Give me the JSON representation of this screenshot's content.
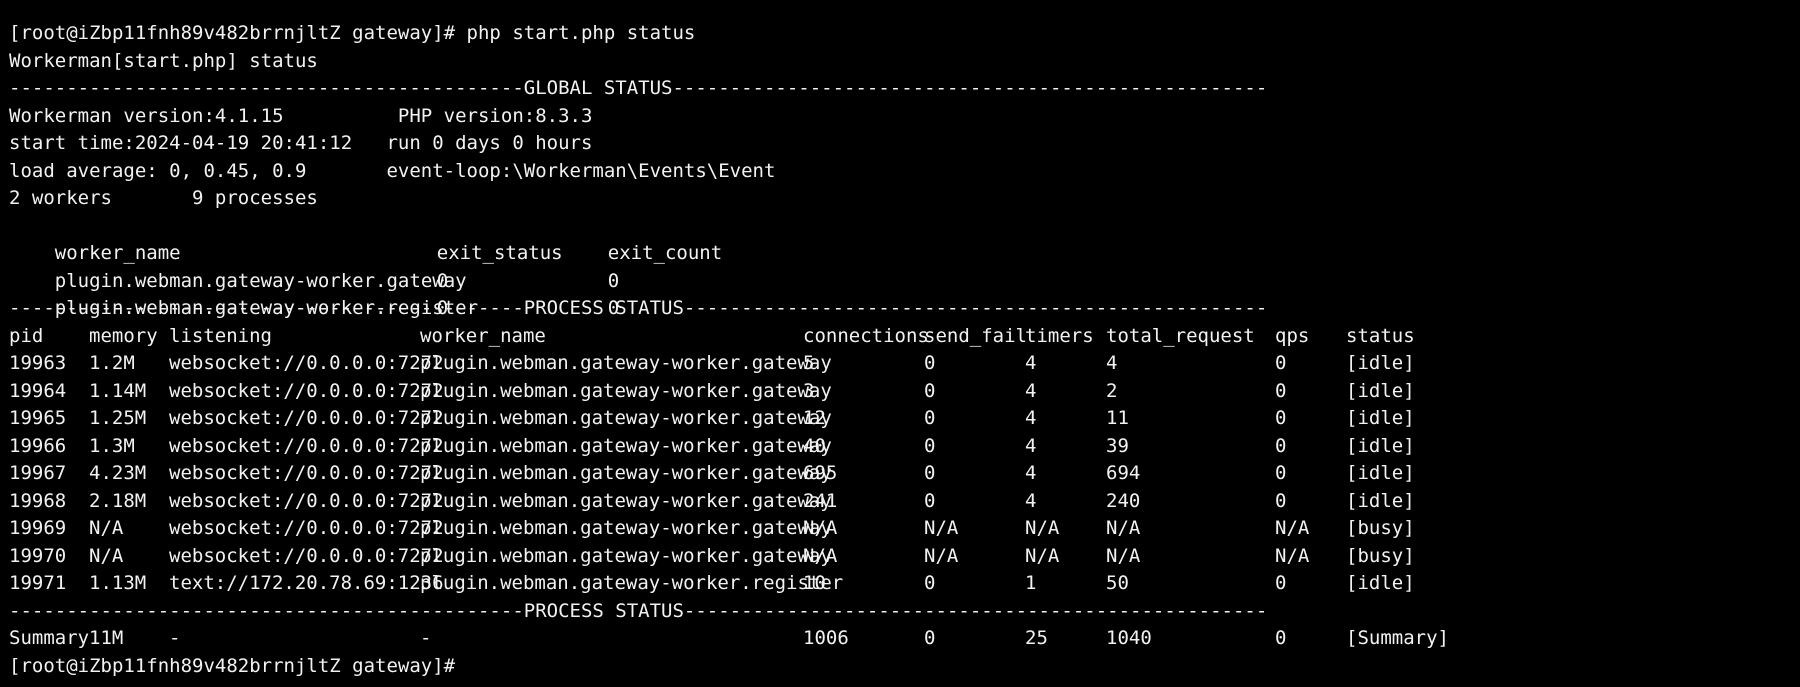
{
  "terminal": {
    "prompt_1": "[root@iZbp11fnh89v482brrnjltZ gateway]# php start.php status",
    "title_line": "Workerman[start.php] status",
    "global_sep": "---------------------------------------------GLOBAL STATUS----------------------------------------------------",
    "global": {
      "version_line": "Workerman version:4.1.15          PHP version:8.3.3",
      "start_line": "start time:2024-04-19 20:41:12   run 0 days 0 hours",
      "load_line": "load average: 0, 0.45, 0.9       event-loop:\\Workerman\\Events\\Event",
      "count_line": "2 workers       9 processes",
      "workers_header": [
        "worker_name",
        "exit_status",
        "exit_count"
      ],
      "workers": [
        [
          "plugin.webman.gateway-worker.gateway",
          "0",
          "0"
        ],
        [
          "plugin.webman.gateway-worker.register",
          "0",
          "0"
        ]
      ]
    },
    "process_sep": "---------------------------------------------PROCESS STATUS---------------------------------------------------",
    "process_header": [
      "pid",
      "memory",
      "listening",
      "worker_name",
      "connections",
      "send_fail",
      "timers",
      "total_request",
      "qps",
      "status"
    ],
    "processes": [
      [
        "19963",
        "1.2M",
        "websocket://0.0.0.0:7272",
        "plugin.webman.gateway-worker.gateway",
        "5",
        "0",
        "4",
        "4",
        "0",
        "[idle]"
      ],
      [
        "19964",
        "1.14M",
        "websocket://0.0.0.0:7272",
        "plugin.webman.gateway-worker.gateway",
        "3",
        "0",
        "4",
        "2",
        "0",
        "[idle]"
      ],
      [
        "19965",
        "1.25M",
        "websocket://0.0.0.0:7272",
        "plugin.webman.gateway-worker.gateway",
        "12",
        "0",
        "4",
        "11",
        "0",
        "[idle]"
      ],
      [
        "19966",
        "1.3M",
        "websocket://0.0.0.0:7272",
        "plugin.webman.gateway-worker.gateway",
        "40",
        "0",
        "4",
        "39",
        "0",
        "[idle]"
      ],
      [
        "19967",
        "4.23M",
        "websocket://0.0.0.0:7272",
        "plugin.webman.gateway-worker.gateway",
        "695",
        "0",
        "4",
        "694",
        "0",
        "[idle]"
      ],
      [
        "19968",
        "2.18M",
        "websocket://0.0.0.0:7272",
        "plugin.webman.gateway-worker.gateway",
        "241",
        "0",
        "4",
        "240",
        "0",
        "[idle]"
      ],
      [
        "19969",
        "N/A",
        "websocket://0.0.0.0:7272",
        "plugin.webman.gateway-worker.gateway",
        "N/A",
        "N/A",
        "N/A",
        "N/A",
        "N/A",
        "[busy]"
      ],
      [
        "19970",
        "N/A",
        "websocket://0.0.0.0:7272",
        "plugin.webman.gateway-worker.gateway",
        "N/A",
        "N/A",
        "N/A",
        "N/A",
        "N/A",
        "[busy]"
      ],
      [
        "19971",
        "1.13M",
        "text://172.20.78.69:1236",
        "plugin.webman.gateway-worker.register",
        "10",
        "0",
        "1",
        "50",
        "0",
        "[idle]"
      ]
    ],
    "process_sep_2": "---------------------------------------------PROCESS STATUS---------------------------------------------------",
    "summary": [
      "Summary",
      "11M",
      "-",
      "-",
      "1006",
      "0",
      "25",
      "1040",
      "0",
      "[Summary]"
    ],
    "prompt_2": "[root@iZbp11fnh89v482brrnjltZ gateway]#"
  },
  "colors": {
    "background": "#000000",
    "text": "#f2f2f2"
  }
}
